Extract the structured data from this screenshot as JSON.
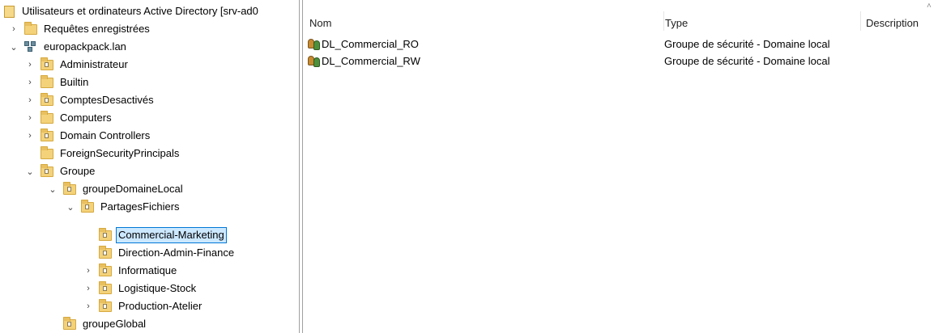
{
  "tree": {
    "root_label": "Utilisateurs et ordinateurs Active Directory [srv-ad0",
    "items": [
      {
        "label": "Requêtes enregistrées",
        "expander": "collapsed",
        "icon": "folder-icon"
      },
      {
        "label": "europackpack.lan",
        "expander": "expanded",
        "icon": "domain-icon"
      },
      {
        "label": "Administrateur",
        "expander": "collapsed",
        "icon": "ou-icon"
      },
      {
        "label": "Builtin",
        "expander": "collapsed",
        "icon": "folder-icon"
      },
      {
        "label": "ComptesDesactivés",
        "expander": "collapsed",
        "icon": "ou-icon"
      },
      {
        "label": "Computers",
        "expander": "collapsed",
        "icon": "folder-icon"
      },
      {
        "label": "Domain Controllers",
        "expander": "collapsed",
        "icon": "ou-icon"
      },
      {
        "label": "ForeignSecurityPrincipals",
        "expander": "none",
        "icon": "folder-icon"
      },
      {
        "label": "Groupe",
        "expander": "expanded",
        "icon": "ou-icon"
      },
      {
        "label": "groupeDomaineLocal",
        "expander": "expanded",
        "icon": "ou-icon"
      },
      {
        "label": "PartagesFichiers",
        "expander": "expanded",
        "icon": "ou-icon"
      },
      {
        "label": "Commercial-Marketing",
        "expander": "none",
        "icon": "ou-icon",
        "selected": true
      },
      {
        "label": "Direction-Admin-Finance",
        "expander": "none",
        "icon": "ou-icon"
      },
      {
        "label": "Informatique",
        "expander": "collapsed",
        "icon": "ou-icon"
      },
      {
        "label": "Logistique-Stock",
        "expander": "collapsed",
        "icon": "ou-icon"
      },
      {
        "label": "Production-Atelier",
        "expander": "collapsed",
        "icon": "ou-icon"
      },
      {
        "label": "groupeGlobal",
        "expander": "none",
        "icon": "ou-icon"
      }
    ]
  },
  "list": {
    "columns": {
      "name": "Nom",
      "type": "Type",
      "description": "Description"
    },
    "rows": [
      {
        "name": "DL_Commercial_RO",
        "type": "Groupe de sécurité - Domaine local",
        "description": ""
      },
      {
        "name": "DL_Commercial_RW",
        "type": "Groupe de sécurité - Domaine local",
        "description": ""
      }
    ]
  },
  "colors": {
    "selection_fill": "#cce8ff",
    "selection_border": "#0078d7",
    "folder": "#f3d27a"
  }
}
